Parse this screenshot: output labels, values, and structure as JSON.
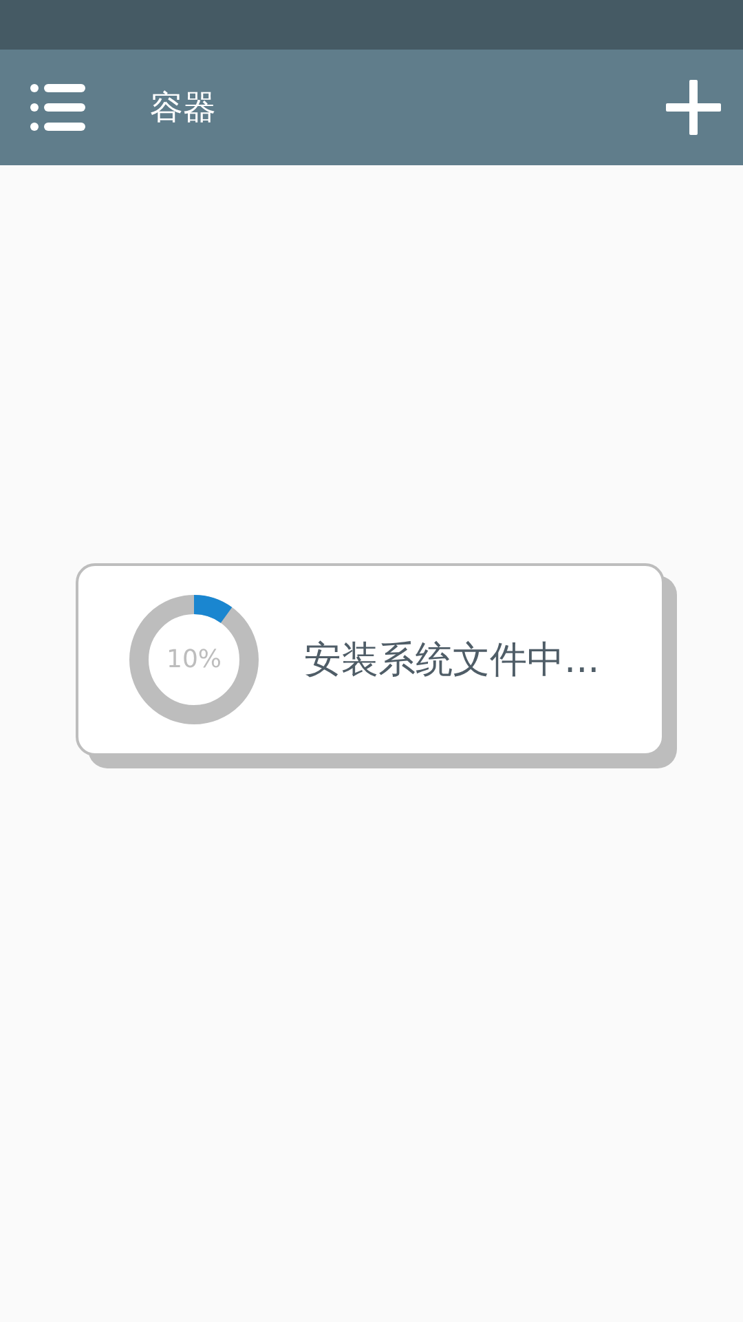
{
  "app_bar": {
    "title": "容器"
  },
  "dialog": {
    "progress": {
      "level": 0.1,
      "reading": "10%"
    },
    "message": "安装系统文件中..."
  }
}
